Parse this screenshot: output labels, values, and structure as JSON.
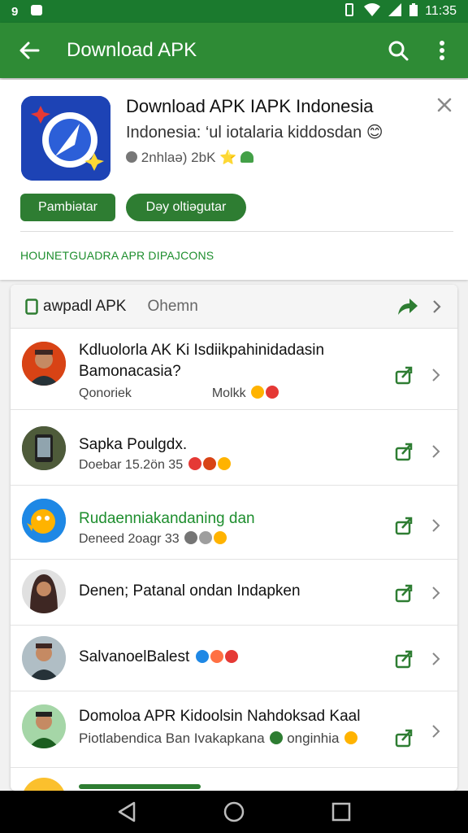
{
  "status_bar": {
    "notification_count": "9",
    "time": "11:35"
  },
  "app_bar": {
    "title": "Download APK",
    "back_icon": "arrow-left-icon",
    "search_icon": "search-icon",
    "more_icon": "more-vert-icon"
  },
  "app_card": {
    "name": "Download APK IAPK Indonesia",
    "subtitle": "Indonesia: ‘ul iotalaria kiddosdan 😊",
    "meta": "2nhlaə) 2bK ⭐",
    "primary_button": "Pambiətar",
    "secondary_button": "Dəy oltiəgutar",
    "section_link": "HOUNETGUADRA APR DIPAJCONS"
  },
  "list_header": {
    "tab_active": "awpadl APK",
    "tab_other": "Ohemn"
  },
  "rows": [
    {
      "title": "Kdluolorla AK Ki Isdiikpahinidadasin",
      "title_line2": "Bamonacasia?",
      "subtitle": "Qonoriek",
      "subtitle2": "Molkk",
      "green": false
    },
    {
      "title": "Sapka Poulgdx.",
      "title_line2": "",
      "subtitle": "Doebar 15.2ön 35",
      "subtitle2": "",
      "green": false
    },
    {
      "title": "Rudaenniakandaning dan",
      "title_line2": "",
      "subtitle": "Deneed 2oagr 33",
      "subtitle2": "",
      "green": true
    },
    {
      "title": "Denen; Patanal ondan Indapken",
      "title_line2": "",
      "subtitle": "",
      "subtitle2": "",
      "green": false
    },
    {
      "title": "SalvanoelBalest",
      "title_line2": "",
      "subtitle": "",
      "subtitle2": "",
      "green": false
    },
    {
      "title": "Domoloa APR Kidoolsin Nahdoksad Kaal",
      "title_line2": "",
      "subtitle": "Piotlabendica Ban Ivakapkana",
      "subtitle2": "onginhia",
      "green": false
    }
  ],
  "colors": {
    "app_bar": "#2e8b35",
    "status_bar": "#1b7a2e",
    "accent_green": "#1e8e2e",
    "button_green": "#2e7d32"
  }
}
